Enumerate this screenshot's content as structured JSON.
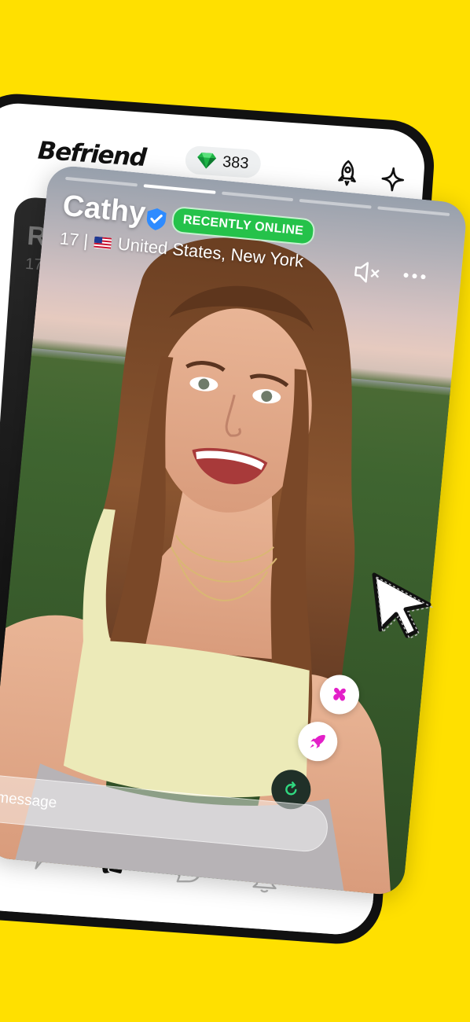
{
  "app": {
    "logo_text": "Befriend",
    "gem_count": "383"
  },
  "header": {
    "icons": [
      "gem-icon",
      "rocket-icon",
      "sparkle-icon"
    ]
  },
  "back_card": {
    "name": "Rul",
    "age": "17 |"
  },
  "profile": {
    "name": "Cathy",
    "verified": true,
    "status_badge": "RECENTLY ONLINE",
    "age": "17 |",
    "location": "United States, New York",
    "story_segments": 5,
    "active_segment": 2
  },
  "card_actions": {
    "icons": [
      "mute-icon",
      "more-icon",
      "gift-icon",
      "boost-icon",
      "undo-icon"
    ]
  },
  "message_bar": {
    "placeholder": "d a message"
  },
  "nav": {
    "items": [
      "lightning-icon",
      "cards-icon",
      "chat-icon",
      "bell-icon"
    ],
    "active": "cards-icon"
  },
  "colors": {
    "background": "#FFE000",
    "online_badge": "#25C24A",
    "verified": "#2E8BFF",
    "accent_magenta": "#E31FC8"
  }
}
